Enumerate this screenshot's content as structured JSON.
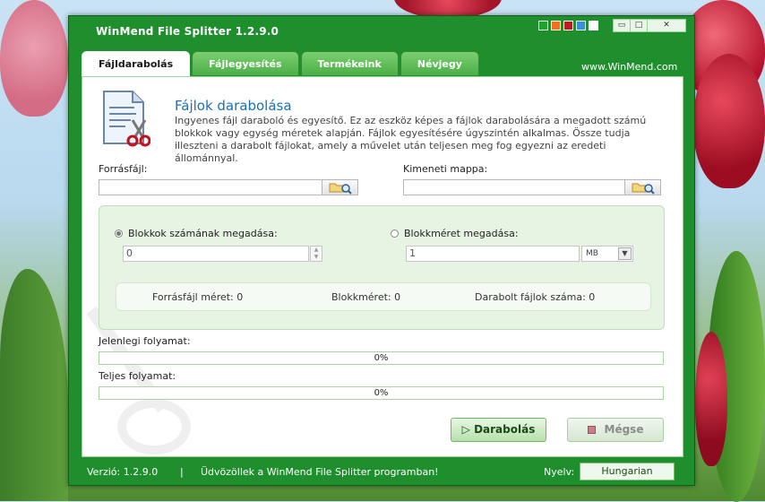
{
  "window": {
    "title": "WinMend File Splitter 1.2.9.0",
    "theme_colors": [
      "#1ea32b",
      "#f26f21",
      "#c01b24",
      "#3a8fd6",
      "#ffffff"
    ],
    "controls": {
      "minimize": "▭",
      "maximize": "□",
      "close": "✕"
    }
  },
  "tabs": [
    {
      "label": "Fájldarabolás",
      "active": true
    },
    {
      "label": "Fájlegyesítés",
      "active": false
    },
    {
      "label": "Termékeink",
      "active": false
    },
    {
      "label": "Névjegy",
      "active": false
    }
  ],
  "site_link": "www.WinMend.com",
  "header": {
    "title": "Fájlok darabolása",
    "description": "Ingyenes fájl daraboló és egyesítő. Ez az eszköz képes a fájlok darabolására a megadott számú blokkok vagy egység méretek alapján. Fájlok egyesítésére úgyszintén alkalmas. Össze tudja illeszteni a darabolt fájlokat, amely a művelet után teljesen meg fog egyezni az eredeti állománnyal."
  },
  "source": {
    "label": "Forrásfájl:",
    "value": ""
  },
  "output": {
    "label": "Kimeneti mappa:",
    "value": ""
  },
  "options": {
    "block_count": {
      "label": "Blokkok számának megadása:",
      "selected": true,
      "value": "0"
    },
    "block_size": {
      "label": "Blokkméret megadása:",
      "selected": false,
      "value": "1",
      "unit": "MB"
    }
  },
  "stats": {
    "source_size": "Forrásfájl méret:  0",
    "block_size": "Blokkméret:  0",
    "part_count": "Darabolt fájlok száma:  0"
  },
  "progress": {
    "current_label": "Jelenlegi folyamat:",
    "current_value": "0%",
    "total_label": "Teljes folyamat:",
    "total_value": "0%"
  },
  "buttons": {
    "split": "Darabolás",
    "cancel": "Mégse",
    "split_glyph": "▷"
  },
  "statusbar": {
    "version": "Verzió:  1.2.9.0",
    "separator": "|",
    "welcome": "Üdvözöllek a WinMend File Splitter programban!",
    "language_label": "Nyelv:",
    "language": "Hungarian"
  }
}
